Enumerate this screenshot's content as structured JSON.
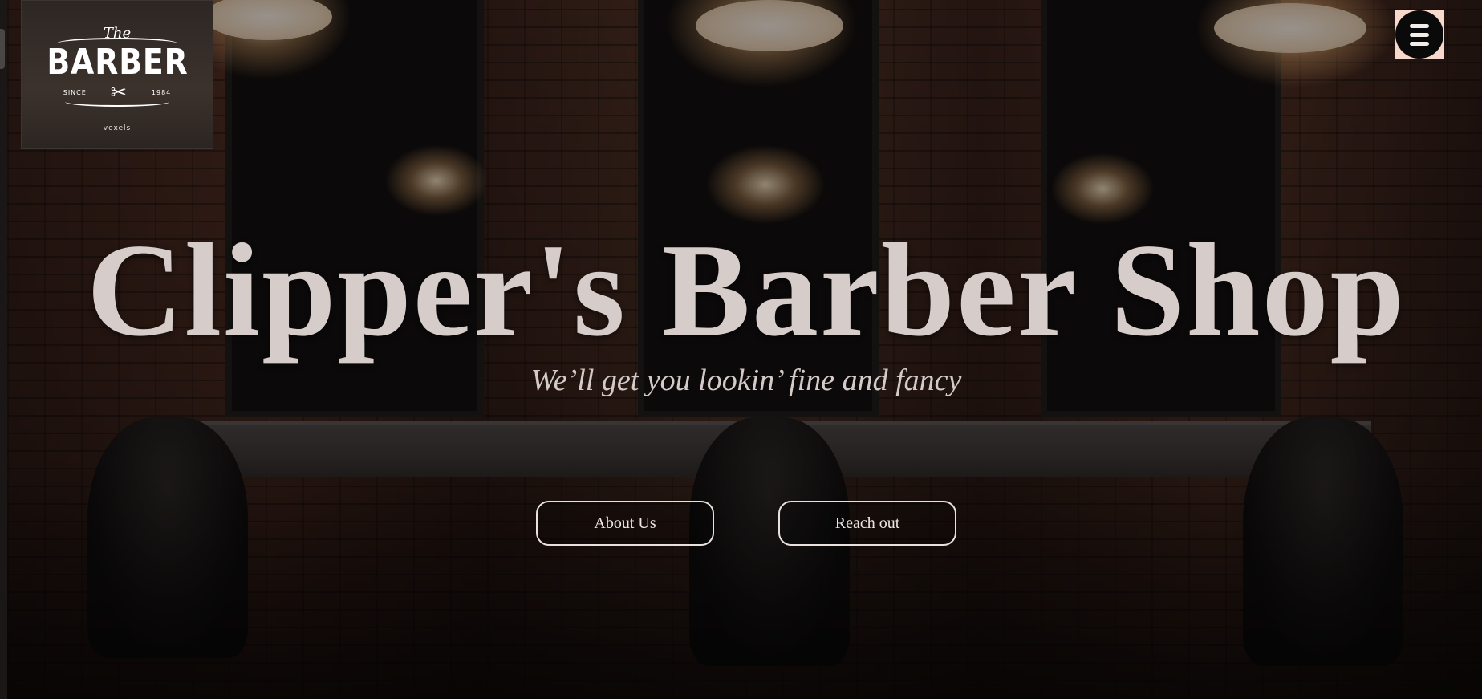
{
  "header": {
    "logo": {
      "the": "The",
      "word": "BARBER",
      "since": "SINCE",
      "year": "1984",
      "credit": "vexels"
    },
    "menu_icon": "hamburger-menu-icon"
  },
  "hero": {
    "title": "Clipper's Barber Shop",
    "tagline": "We’ll get you lookin’ fine and fancy",
    "buttons": {
      "about": "About Us",
      "reach": "Reach out"
    }
  },
  "colors": {
    "title_text": "#d6cdcb",
    "button_border": "#e8e1de",
    "menu_button_bg": "#f6d9cc",
    "menu_circle": "#0b0a0a"
  }
}
